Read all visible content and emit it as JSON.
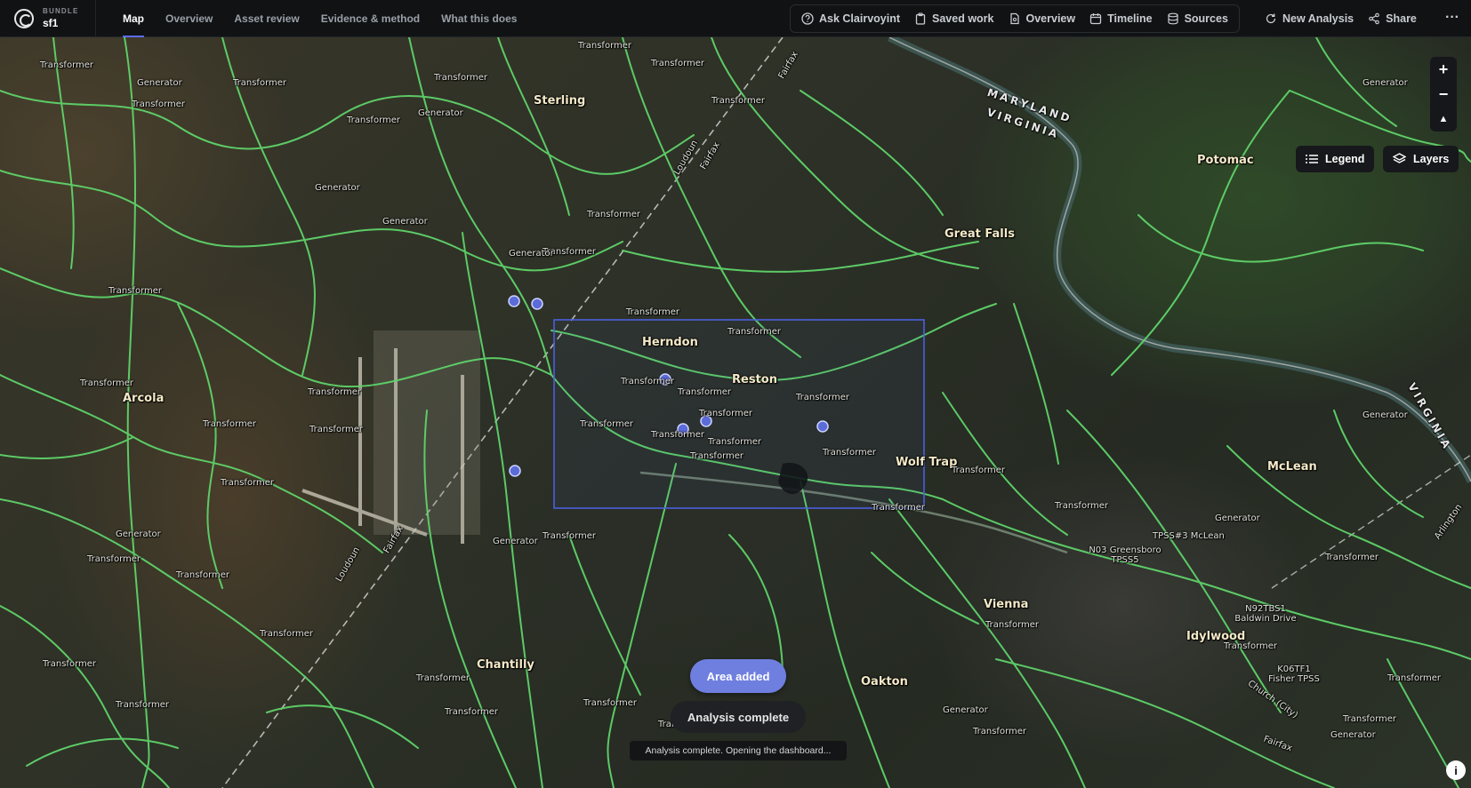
{
  "brand": {
    "kicker": "BUNDLE",
    "name": "sf1",
    "logo_icon": "clairvoyint-logo-icon"
  },
  "nav": {
    "tabs": [
      {
        "label": "Map",
        "active": true
      },
      {
        "label": "Overview",
        "active": false
      },
      {
        "label": "Asset review",
        "active": false
      },
      {
        "label": "Evidence & method",
        "active": false
      },
      {
        "label": "What this does",
        "active": false
      }
    ]
  },
  "toolbar": {
    "items": [
      {
        "label": "Ask Clairvoyint",
        "icon": "help-circle-icon"
      },
      {
        "label": "Saved work",
        "icon": "clipboard-icon"
      },
      {
        "label": "Overview",
        "icon": "document-icon"
      },
      {
        "label": "Timeline",
        "icon": "calendar-icon"
      },
      {
        "label": "Sources",
        "icon": "database-icon"
      }
    ],
    "new_analysis": "New Analysis",
    "share": "Share",
    "more": "···"
  },
  "map": {
    "controls": {
      "zoom_in": "+",
      "zoom_out": "−",
      "reset_north": "▲"
    },
    "legend_label": "Legend",
    "layers_label": "Layers",
    "colors": {
      "lines": "#5fd36a",
      "selection": "#4b5fe0",
      "accent": "#6f7fe0"
    },
    "places": [
      "Sterling",
      "Herndon",
      "Reston",
      "Great Falls",
      "Potomac",
      "Wolf Trap",
      "Arcola",
      "McLean",
      "Vienna",
      "Idylwood",
      "Oakton",
      "Chantilly"
    ],
    "state_labels": [
      "MARYLAND",
      "VIRGINIA",
      "VIRGINIA"
    ],
    "county_labels": [
      "Loudoun",
      "Fairfax",
      "Loudoun",
      "Fairfax",
      "Fairfax",
      "Arlington",
      "Church (City)",
      "Fairfax"
    ],
    "substations": [
      "N03 Greensboro TPSS5",
      "TPSS#3 McLean",
      "N92TBS1 Baldwin Drive",
      "K06TF1 Fisher TPSS"
    ],
    "asset_label_transformer": "Transformer",
    "asset_label_generator": "Generator"
  },
  "status": {
    "area_added": "Area added",
    "analysis_complete": "Analysis complete",
    "toast": "Analysis complete. Opening the dashboard..."
  },
  "info_icon": "info-icon"
}
